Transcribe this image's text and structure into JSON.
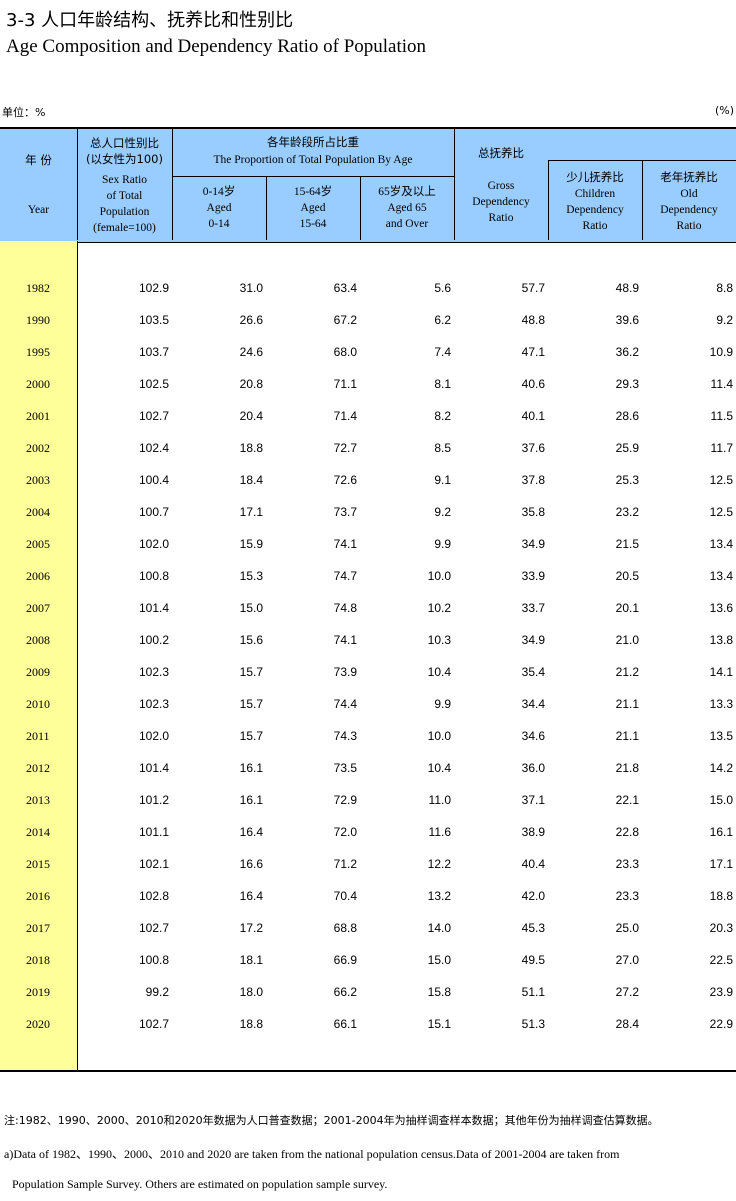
{
  "title_cn": "3-3   人口年龄结构、抚养比和性别比",
  "title_en": "Age Composition and Dependency Ratio of Population",
  "unit": "单位：%",
  "unit_right": "(%)",
  "headers": {
    "year_cn": "年  份",
    "year_en": "Year",
    "sex_ratio_cn": "总人口性别比\n(以女性为100)",
    "sex_ratio_en": "Sex Ratio\nof Total\nPopulation\n(female=100)",
    "proportion_cn": "各年龄段所占比重",
    "proportion_en": "The Proportion of Total Population By Age",
    "age_0_14": "0-14岁\nAged\n0-14",
    "age_15_64": "15-64岁\nAged\n15-64",
    "age_65": "65岁及以上\nAged 65\nand Over",
    "dependency_cn": "总抚养比",
    "gross": "Gross\nDependency\nRatio",
    "children": "少儿抚养比\nChildren\nDependency\nRatio",
    "old": "老年抚养比\nOld\nDependency\nRatio"
  },
  "rows": [
    [
      "1982",
      "102.9",
      "31.0",
      "63.4",
      "5.6",
      "57.7",
      "48.9",
      "8.8"
    ],
    [
      "1990",
      "103.5",
      "26.6",
      "67.2",
      "6.2",
      "48.8",
      "39.6",
      "9.2"
    ],
    [
      "1995",
      "103.7",
      "24.6",
      "68.0",
      "7.4",
      "47.1",
      "36.2",
      "10.9"
    ],
    [
      "2000",
      "102.5",
      "20.8",
      "71.1",
      "8.1",
      "40.6",
      "29.3",
      "11.4"
    ],
    [
      "2001",
      "102.7",
      "20.4",
      "71.4",
      "8.2",
      "40.1",
      "28.6",
      "11.5"
    ],
    [
      "2002",
      "102.4",
      "18.8",
      "72.7",
      "8.5",
      "37.6",
      "25.9",
      "11.7"
    ],
    [
      "2003",
      "100.4",
      "18.4",
      "72.6",
      "9.1",
      "37.8",
      "25.3",
      "12.5"
    ],
    [
      "2004",
      "100.7",
      "17.1",
      "73.7",
      "9.2",
      "35.8",
      "23.2",
      "12.5"
    ],
    [
      "2005",
      "102.0",
      "15.9",
      "74.1",
      "9.9",
      "34.9",
      "21.5",
      "13.4"
    ],
    [
      "2006",
      "100.8",
      "15.3",
      "74.7",
      "10.0",
      "33.9",
      "20.5",
      "13.4"
    ],
    [
      "2007",
      "101.4",
      "15.0",
      "74.8",
      "10.2",
      "33.7",
      "20.1",
      "13.6"
    ],
    [
      "2008",
      "100.2",
      "15.6",
      "74.1",
      "10.3",
      "34.9",
      "21.0",
      "13.8"
    ],
    [
      "2009",
      "102.3",
      "15.7",
      "73.9",
      "10.4",
      "35.4",
      "21.2",
      "14.1"
    ],
    [
      "2010",
      "102.3",
      "15.7",
      "74.4",
      "9.9",
      "34.4",
      "21.1",
      "13.3"
    ],
    [
      "2011",
      "102.0",
      "15.7",
      "74.3",
      "10.0",
      "34.6",
      "21.1",
      "13.5"
    ],
    [
      "2012",
      "101.4",
      "16.1",
      "73.5",
      "10.4",
      "36.0",
      "21.8",
      "14.2"
    ],
    [
      "2013",
      "101.2",
      "16.1",
      "72.9",
      "11.0",
      "37.1",
      "22.1",
      "15.0"
    ],
    [
      "2014",
      "101.1",
      "16.4",
      "72.0",
      "11.6",
      "38.9",
      "22.8",
      "16.1"
    ],
    [
      "2015",
      "102.1",
      "16.6",
      "71.2",
      "12.2",
      "40.4",
      "23.3",
      "17.1"
    ],
    [
      "2016",
      "102.8",
      "16.4",
      "70.4",
      "13.2",
      "42.0",
      "23.3",
      "18.8"
    ],
    [
      "2017",
      "102.7",
      "17.2",
      "68.8",
      "14.0",
      "45.3",
      "25.0",
      "20.3"
    ],
    [
      "2018",
      "100.8",
      "18.1",
      "66.9",
      "15.0",
      "49.5",
      "27.0",
      "22.5"
    ],
    [
      "2019",
      "99.2",
      "18.0",
      "66.2",
      "15.8",
      "51.1",
      "27.2",
      "23.9"
    ],
    [
      "2020",
      "102.7",
      "18.8",
      "66.1",
      "15.1",
      "51.3",
      "28.4",
      "22.9"
    ]
  ],
  "notes": {
    "cn": "注:1982、1990、2000、2010和2020年数据为人口普查数据；2001-2004年为抽样调查样本数据；其他年份为抽样调查估算数据。",
    "en1": "a)Data of 1982、1990、2000、2010 and 2020 are taken from the national population census.Data of 2001-2004 are taken from",
    "en2": "Population Sample Survey. Others are estimated on population sample survey."
  }
}
